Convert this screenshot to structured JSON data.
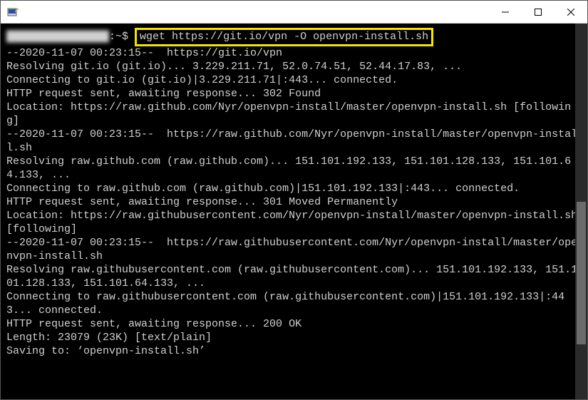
{
  "titlebar": {
    "app_icon": "putty-icon",
    "minimize": "—",
    "maximize": "▢",
    "close": "✕"
  },
  "terminal": {
    "prompt_user_blurred": "████████████████",
    "prompt_tail": ":~$ ",
    "command": "wget https://git.io/vpn -O openvpn-install.sh",
    "lines": [
      "--2020-11-07 00:23:15--  https://git.io/vpn",
      "Resolving git.io (git.io)... 3.229.211.71, 52.0.74.51, 52.44.17.83, ...",
      "Connecting to git.io (git.io)|3.229.211.71|:443... connected.",
      "HTTP request sent, awaiting response... 302 Found",
      "Location: https://raw.github.com/Nyr/openvpn-install/master/openvpn-install.sh [following]",
      "--2020-11-07 00:23:15--  https://raw.github.com/Nyr/openvpn-install/master/openvpn-install.sh",
      "Resolving raw.github.com (raw.github.com)... 151.101.192.133, 151.101.128.133, 151.101.64.133, ...",
      "Connecting to raw.github.com (raw.github.com)|151.101.192.133|:443... connected.",
      "HTTP request sent, awaiting response... 301 Moved Permanently",
      "Location: https://raw.githubusercontent.com/Nyr/openvpn-install/master/openvpn-install.sh [following]",
      "--2020-11-07 00:23:15--  https://raw.githubusercontent.com/Nyr/openvpn-install/master/openvpn-install.sh",
      "Resolving raw.githubusercontent.com (raw.githubusercontent.com)... 151.101.192.133, 151.101.128.133, 151.101.64.133, ...",
      "Connecting to raw.githubusercontent.com (raw.githubusercontent.com)|151.101.192.133|:443... connected.",
      "HTTP request sent, awaiting response... 200 OK",
      "Length: 23079 (23K) [text/plain]",
      "Saving to: ‘openvpn-install.sh’"
    ]
  }
}
